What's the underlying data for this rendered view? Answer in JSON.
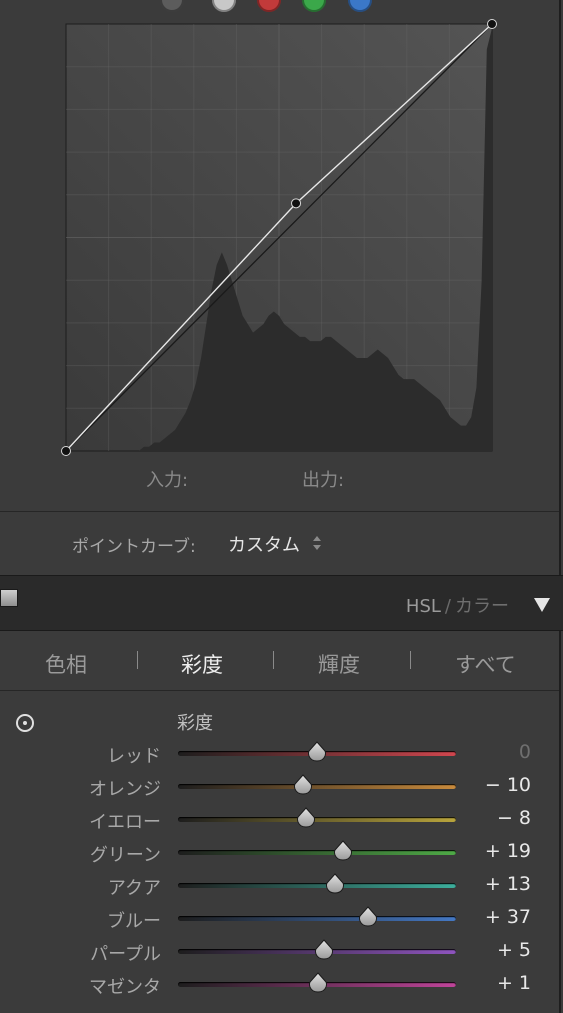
{
  "top_strip": {
    "colors": [
      "#5c5c5c",
      "#c8c8c8",
      "#c23a3a",
      "#3ba84a",
      "#3b78c8"
    ]
  },
  "tone_curve": {
    "input_label": "入力:",
    "output_label": "出力:",
    "control_points": [
      [
        0,
        0
      ],
      [
        0.54,
        0.58
      ],
      [
        1,
        1
      ]
    ],
    "histogram_levels": [
      0,
      0,
      0,
      0,
      0,
      0,
      0,
      0,
      0,
      0,
      0,
      0,
      0,
      0,
      0,
      0.01,
      0.01,
      0.02,
      0.02,
      0.03,
      0.04,
      0.05,
      0.07,
      0.09,
      0.12,
      0.16,
      0.22,
      0.3,
      0.38,
      0.44,
      0.47,
      0.44,
      0.4,
      0.36,
      0.32,
      0.3,
      0.28,
      0.29,
      0.3,
      0.32,
      0.33,
      0.32,
      0.3,
      0.29,
      0.28,
      0.27,
      0.27,
      0.26,
      0.26,
      0.26,
      0.27,
      0.27,
      0.26,
      0.25,
      0.24,
      0.23,
      0.22,
      0.22,
      0.22,
      0.23,
      0.24,
      0.23,
      0.22,
      0.2,
      0.18,
      0.17,
      0.17,
      0.17,
      0.16,
      0.15,
      0.14,
      0.13,
      0.12,
      0.1,
      0.08,
      0.07,
      0.06,
      0.06,
      0.08,
      0.15,
      0.4,
      0.95,
      1
    ]
  },
  "point_curve": {
    "label": "ポイントカーブ:",
    "value": "カスタム"
  },
  "hsl_header": {
    "title_primary": "HSL",
    "separator": "/",
    "title_secondary": "カラー"
  },
  "tabs": [
    {
      "label": "色相",
      "active": false
    },
    {
      "label": "彩度",
      "active": true
    },
    {
      "label": "輝度",
      "active": false
    },
    {
      "label": "すべて",
      "active": false
    }
  ],
  "section_title": "彩度",
  "sliders": [
    {
      "label": "レッド",
      "value": 0,
      "display": "0",
      "track_color": "#d0464e"
    },
    {
      "label": "オレンジ",
      "value": -10,
      "display": "− 10",
      "track_color": "#c88a3c"
    },
    {
      "label": "イエロー",
      "value": -8,
      "display": "− 8",
      "track_color": "#b8a43c"
    },
    {
      "label": "グリーン",
      "value": 19,
      "display": "+ 19",
      "track_color": "#4eaa46"
    },
    {
      "label": "アクア",
      "value": 13,
      "display": "+ 13",
      "track_color": "#3cae9c"
    },
    {
      "label": "ブルー",
      "value": 37,
      "display": "+ 37",
      "track_color": "#4478c4"
    },
    {
      "label": "パープル",
      "value": 5,
      "display": "+ 5",
      "track_color": "#8e54be"
    },
    {
      "label": "マゼンタ",
      "value": 1,
      "display": "+ 1",
      "track_color": "#c0449a"
    }
  ]
}
